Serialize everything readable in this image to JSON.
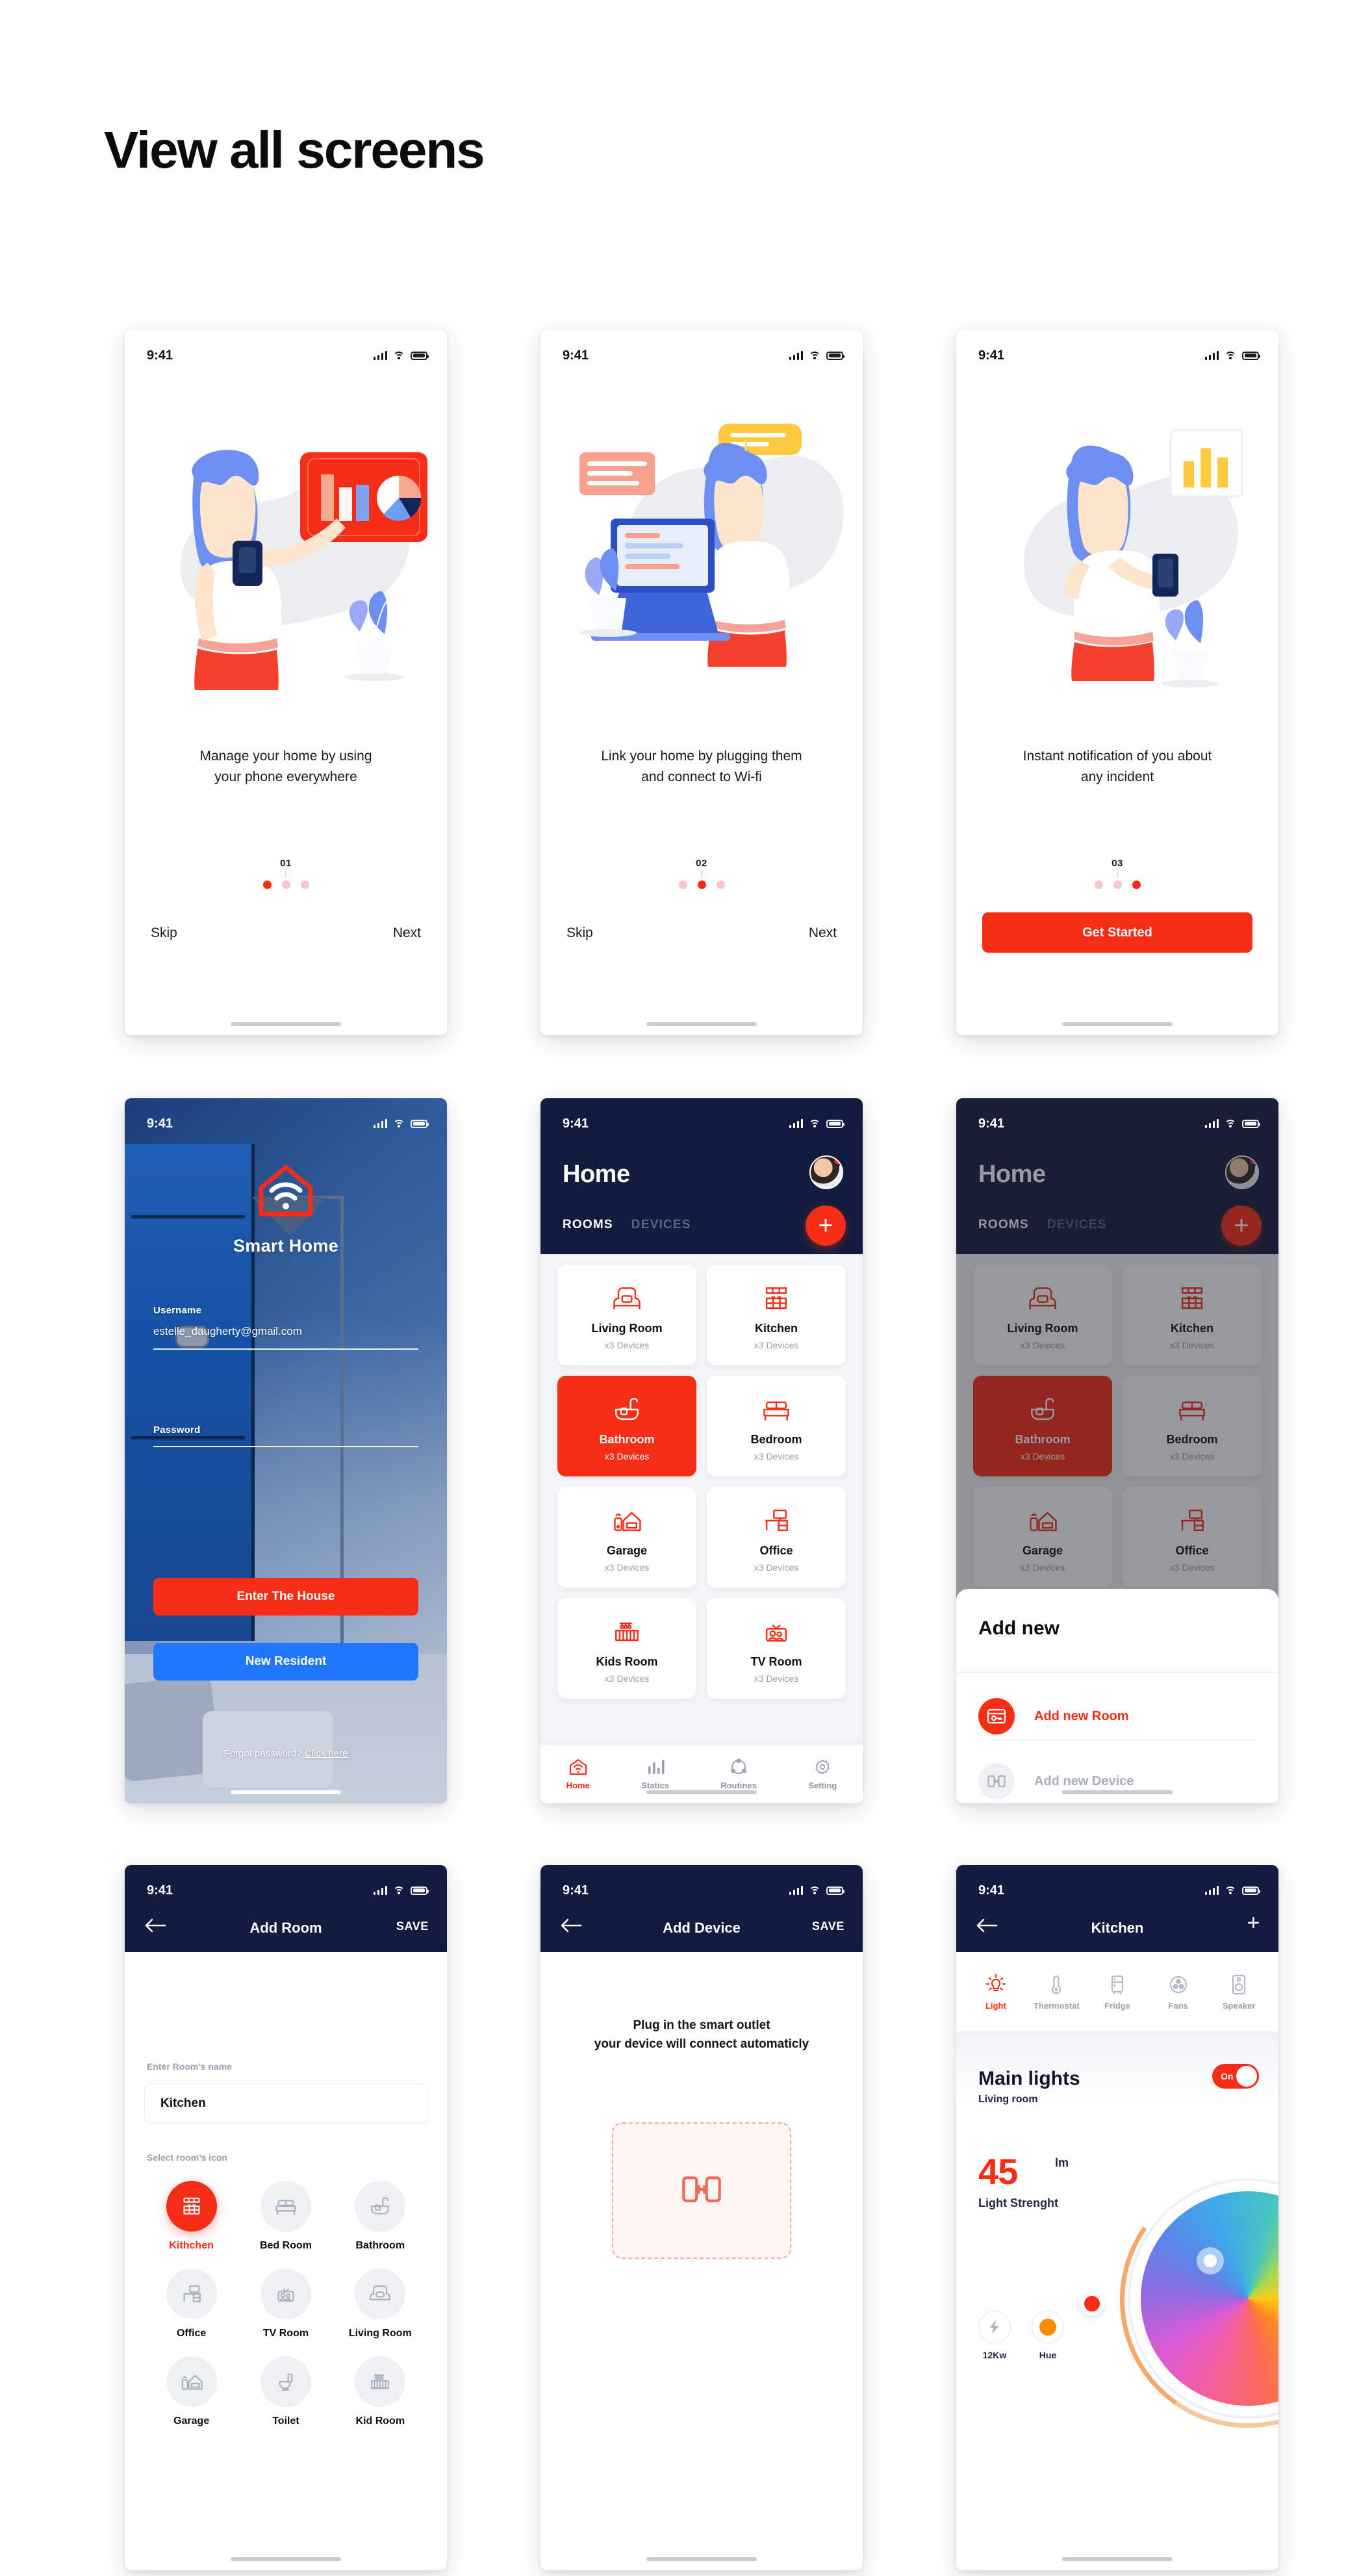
{
  "page": {
    "title": "View all screens"
  },
  "status_bar": {
    "time": "9:41",
    "signal": "signal-bars",
    "wifi": "wifi",
    "battery": "battery-full"
  },
  "onboarding": [
    {
      "text": "Manage your home by using\nyour phone everywhere",
      "line1": "Manage your home by using",
      "line2": "your phone everywhere",
      "step": "01",
      "active_index": 0,
      "skip": "Skip",
      "next": "Next"
    },
    {
      "line1": "Link your home by plugging them",
      "line2": "and connect to Wi-fi",
      "step": "02",
      "active_index": 1,
      "skip": "Skip",
      "next": "Next"
    },
    {
      "line1": "Instant notification of you about",
      "line2": "any incident",
      "step": "03",
      "active_index": 2,
      "cta": "Get Started"
    }
  ],
  "login": {
    "brand": "Smart Home",
    "username_label": "Username",
    "username_value": "estelle_daugherty@gmail.com",
    "password_label": "Password",
    "password_value": "",
    "primary_button": "Enter The House",
    "secondary_button": "New Resident",
    "forgot_prefix": "Forgot password? ",
    "forgot_link": "Click here"
  },
  "home": {
    "title": "Home",
    "tabs": [
      {
        "label": "ROOMS",
        "active": true
      },
      {
        "label": "DEVICES",
        "active": false
      }
    ],
    "add_button": "+",
    "rooms": [
      {
        "name": "Living Room",
        "devices": "x3 Devices",
        "icon": "sofa-icon",
        "selected": false
      },
      {
        "name": "Kitchen",
        "devices": "x3 Devices",
        "icon": "kitchen-icon",
        "selected": false
      },
      {
        "name": "Bathroom",
        "devices": "x3 Devices",
        "icon": "bathtub-icon",
        "selected": true
      },
      {
        "name": "Bedroom",
        "devices": "x3 Devices",
        "icon": "bed-icon",
        "selected": false
      },
      {
        "name": "Garage",
        "devices": "x3 Devices",
        "icon": "garage-icon",
        "selected": false
      },
      {
        "name": "Office",
        "devices": "x3 Devices",
        "icon": "desk-icon",
        "selected": false
      },
      {
        "name": "Kids Room",
        "devices": "x3 Devices",
        "icon": "crib-icon",
        "selected": false
      },
      {
        "name": "TV Room",
        "devices": "x3 Devices",
        "icon": "tv-icon",
        "selected": false
      }
    ],
    "tabbar": [
      {
        "label": "Home",
        "icon": "home-wifi-icon",
        "active": true
      },
      {
        "label": "Statics",
        "icon": "bar-chart-icon",
        "active": false
      },
      {
        "label": "Routines",
        "icon": "routines-icon",
        "active": false
      },
      {
        "label": "Setting",
        "icon": "gear-icon",
        "active": false
      }
    ]
  },
  "add_new_sheet": {
    "title": "Add new",
    "options": [
      {
        "label": "Add new Room",
        "icon": "room-key-card-icon",
        "active": true
      },
      {
        "label": "Add new Device",
        "icon": "device-link-icon",
        "active": false
      }
    ]
  },
  "add_room": {
    "back": "back-arrow",
    "title": "Add Room",
    "save": "SAVE",
    "name_label": "Enter Room’s name",
    "name_value": "Kitchen",
    "icon_label": "Select room’s icon",
    "icons": [
      {
        "label": "Kithchen",
        "icon": "kitchen-icon",
        "selected": true
      },
      {
        "label": "Bed Room",
        "icon": "bed-icon",
        "selected": false
      },
      {
        "label": "Bathroom",
        "icon": "bathtub-icon",
        "selected": false
      },
      {
        "label": "Office",
        "icon": "desk-icon",
        "selected": false
      },
      {
        "label": "TV Room",
        "icon": "tv-icon",
        "selected": false
      },
      {
        "label": "Living Room",
        "icon": "sofa-icon",
        "selected": false
      },
      {
        "label": "Garage",
        "icon": "garage-icon",
        "selected": false
      },
      {
        "label": "Toilet",
        "icon": "toilet-icon",
        "selected": false
      },
      {
        "label": "Kid Room",
        "icon": "crib-icon",
        "selected": false
      }
    ]
  },
  "add_device": {
    "back": "back-arrow",
    "title": "Add Device",
    "save": "SAVE",
    "line1": "Plug in the smart outlet",
    "line2": "your device will connect automaticly",
    "placeholder_icon": "device-link-icon"
  },
  "kitchen": {
    "back": "back-arrow",
    "title": "Kitchen",
    "add": "+",
    "devices": [
      {
        "label": "Light",
        "icon": "bulb-icon",
        "active": true
      },
      {
        "label": "Thermostat",
        "icon": "thermometer-icon",
        "active": false
      },
      {
        "label": "Fridge",
        "icon": "fridge-icon",
        "active": false
      },
      {
        "label": "Fans",
        "icon": "fan-icon",
        "active": false
      },
      {
        "label": "Speaker",
        "icon": "speaker-icon",
        "active": false
      }
    ],
    "device_name": "Main lights",
    "device_room": "Living room",
    "toggle_state": "On",
    "strength_value": "45",
    "strength_unit": "lm",
    "strength_label": "Light Strenght",
    "stats": [
      {
        "label": "12Kw",
        "icon": "bolt-icon"
      },
      {
        "label": "Hue",
        "icon": "hue-color-dot-icon"
      }
    ]
  },
  "colors": {
    "accent_red": "#f52d16",
    "navy": "#121c3e",
    "blue": "#2176ff",
    "muted": "#9aa0ad",
    "surface": "#f4f5f7"
  }
}
